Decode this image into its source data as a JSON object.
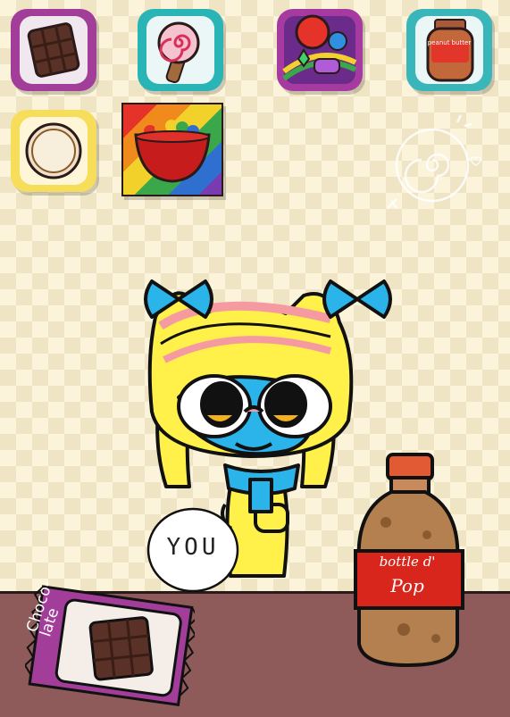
{
  "inventory": {
    "items": [
      {
        "id": "slot-choc",
        "name": "chocolate-slot"
      },
      {
        "id": "slot-lolli",
        "name": "lollipop-slot"
      },
      {
        "id": "slot-candy",
        "name": "candy-slot"
      },
      {
        "id": "slot-pb",
        "name": "peanut-butter-slot",
        "text": "peanut butter"
      },
      {
        "id": "slot-cookie",
        "name": "cookie-slot"
      },
      {
        "id": "slot-bowl",
        "name": "candy-bowl-slot"
      }
    ]
  },
  "scene": {
    "speech_bubble_text": "YOU",
    "bottle_label_line1": "bottle d'",
    "bottle_label_line2": "Pop",
    "chocolate_wrapper_text": "Choco-\nlate"
  },
  "colors": {
    "background": "#fbf3da",
    "counter": "#8e5a5a",
    "character_yellow": "#fff04a",
    "character_blue": "#2ab4ea",
    "character_pink": "#f49aa0",
    "bottle_label_red": "#d9261c"
  }
}
